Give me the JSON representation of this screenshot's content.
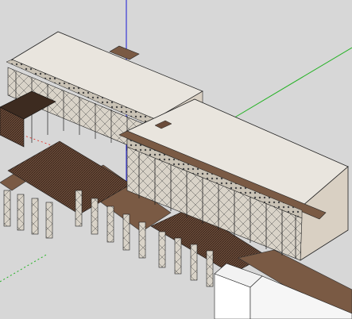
{
  "viewport": {
    "background": "#d7d7d7",
    "axis_colors": {
      "red": "#e0241b",
      "green": "#23b223",
      "blue": "#1a1ad6"
    }
  },
  "model": {
    "roof_color": "#e9e5de",
    "wall_color": "#d9d0c3",
    "wood_color": "#7a5a44",
    "dark_wood_color": "#3d2b20"
  }
}
